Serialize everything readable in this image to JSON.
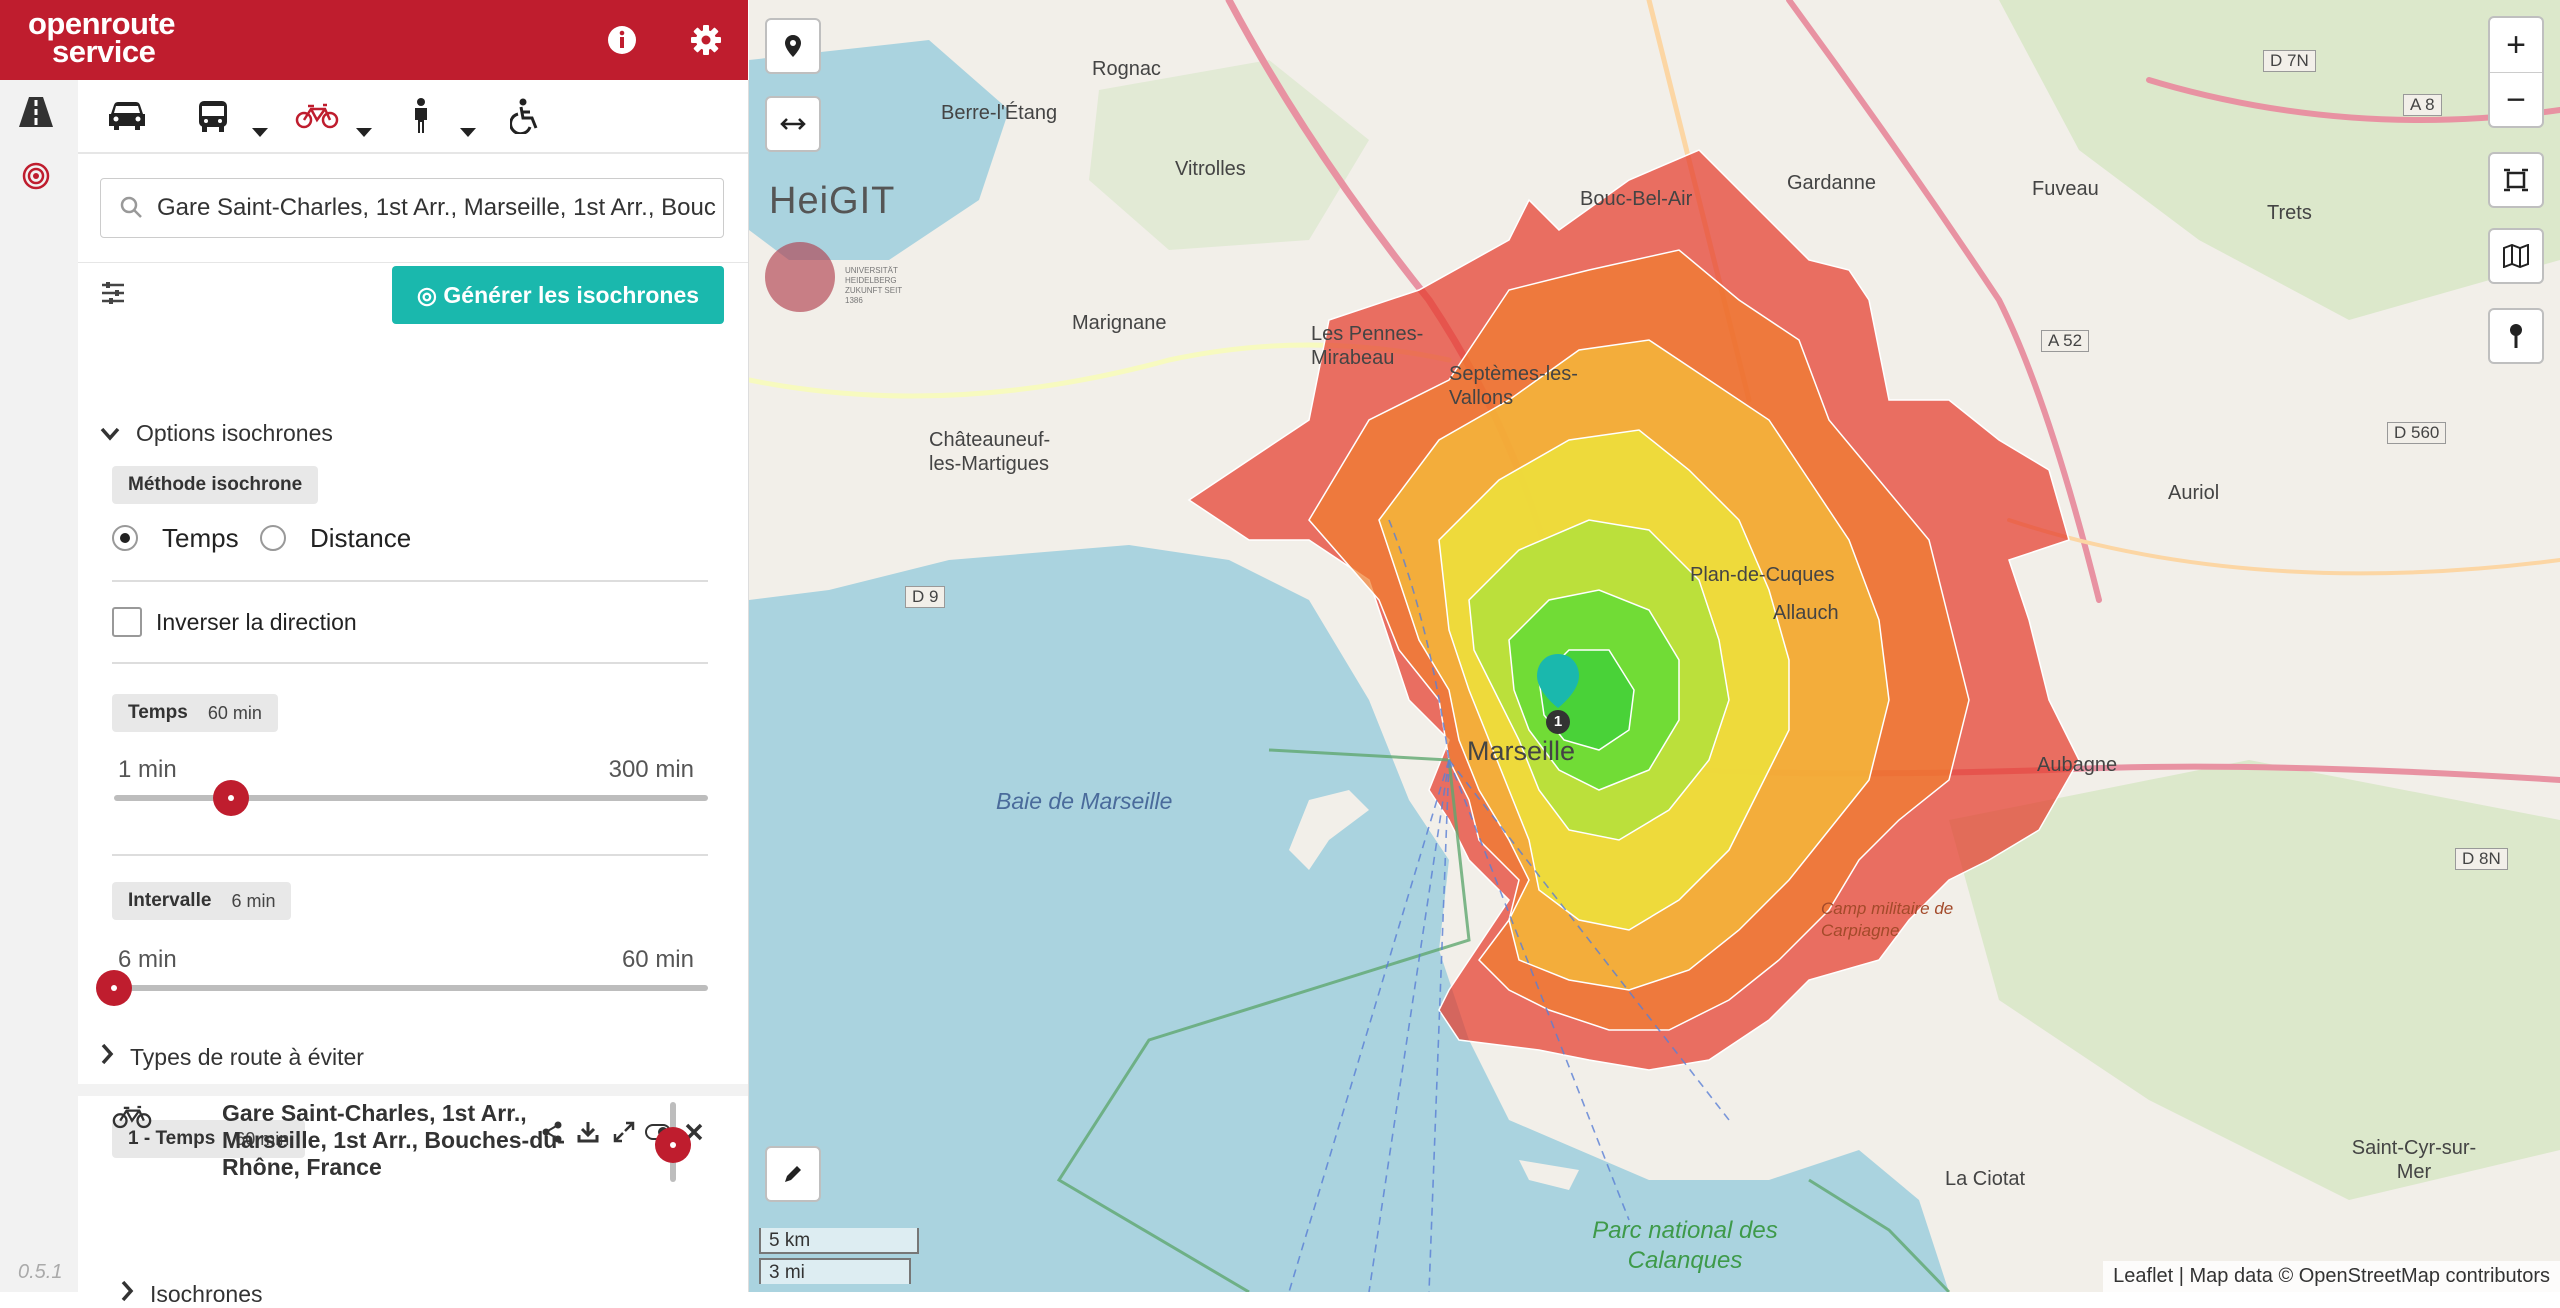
{
  "app": {
    "logo_line1": "openroute",
    "logo_line2": "service",
    "version": "0.5.1"
  },
  "search": {
    "value": "Gare Saint-Charles, 1st Arr., Marseille, 1st Arr., Bouc"
  },
  "actions": {
    "generate": "◎ Générer les isochrones"
  },
  "options": {
    "heading": "Options isochrones",
    "method_label": "Méthode isochrone",
    "radio_time": "Temps",
    "radio_distance": "Distance",
    "selected_method": "Temps",
    "invert_label": "Inverser la direction",
    "invert_checked": false,
    "time_label": "Temps",
    "time_value": "60 min",
    "time_min": "1 min",
    "time_max": "300 min",
    "time_level": 60,
    "interval_label": "Intervalle",
    "interval_value": "6 min",
    "interval_min": "6 min",
    "interval_max": "60 min",
    "interval_level": 6,
    "avoid_label": "Types de route à éviter"
  },
  "result": {
    "badge": "1 - Temps",
    "badge_value": "60 min",
    "address": "Gare Saint-Charles, 1st Arr., Marseille, 1st Arr., Bouches-du-Rhône, France",
    "sub": "Isochrones",
    "opacity_level": 0.5
  },
  "map": {
    "marker_number": "1",
    "heigit": "HeiGIT",
    "uni_text": "UNIVERSITÄT HEIDELBERG ZUKUNFT SEIT 1386",
    "scale_km": "5 km",
    "scale_mi": "3 mi",
    "attribution": "Leaflet | Map data © OpenStreetMap contributors",
    "labels": [
      {
        "text": "Rognac"
      },
      {
        "text": "Berre-l'Étang"
      },
      {
        "text": "Vitrolles"
      },
      {
        "text": "Bouc-Bel-Air"
      },
      {
        "text": "Gardanne"
      },
      {
        "text": "Fuveau"
      },
      {
        "text": "Trets"
      },
      {
        "text": "Marignane"
      },
      {
        "text": "Les Pennes-Mirabeau"
      },
      {
        "text": "Septèmes-les-Vallons"
      },
      {
        "text": "Châteauneuf-les-Martigues"
      },
      {
        "text": "Plan-de-Cuques"
      },
      {
        "text": "Allauch"
      },
      {
        "text": "Marseille"
      },
      {
        "text": "Aubagne"
      },
      {
        "text": "Auriol"
      },
      {
        "text": "Baie de Marseille"
      },
      {
        "text": "Camp militaire de Carpiagne"
      },
      {
        "text": "La Ciotat"
      },
      {
        "text": "Saint-Cyr-sur-Mer"
      },
      {
        "text": "Parc national des Calanques"
      },
      {
        "text": "D 7N"
      },
      {
        "text": "A 8"
      },
      {
        "text": "A 52"
      },
      {
        "text": "D 560"
      },
      {
        "text": "D 9"
      },
      {
        "text": "D 8N"
      }
    ],
    "accent": "#bf1d2e",
    "teal": "#1ab8ad"
  }
}
